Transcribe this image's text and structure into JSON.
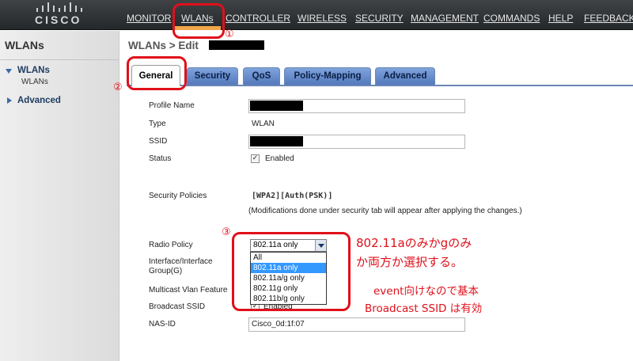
{
  "brand": {
    "logo_text": "CISCO"
  },
  "nav": {
    "items": [
      "MONITOR",
      "WLANs",
      "CONTROLLER",
      "WIRELESS",
      "SECURITY",
      "MANAGEMENT",
      "COMMANDS",
      "HELP",
      "FEEDBACK"
    ],
    "active": "WLANs",
    "accent_color": "#f2a64a"
  },
  "sidebar": {
    "title": "WLANs",
    "items": [
      {
        "label": "WLANs",
        "expanded": true,
        "sub": [
          "WLANs"
        ]
      },
      {
        "label": "Advanced",
        "expanded": false
      }
    ]
  },
  "page": {
    "title": "WLANs > Edit"
  },
  "tabs": [
    {
      "label": "General",
      "active": true
    },
    {
      "label": "Security"
    },
    {
      "label": "QoS"
    },
    {
      "label": "Policy-Mapping"
    },
    {
      "label": "Advanced"
    }
  ],
  "form": {
    "profile_name_label": "Profile Name",
    "type_label": "Type",
    "type_value": "WLAN",
    "ssid_label": "SSID",
    "status_label": "Status",
    "status_checkbox_label": "Enabled",
    "status_checked": true,
    "security_policies_label": "Security Policies",
    "security_policies_value": "[WPA2][Auth(PSK)]",
    "security_note": "(Modifications done under security tab will appear after applying the changes.)",
    "radio_policy_label": "Radio Policy",
    "radio_policy_selected": "802.11a only",
    "radio_policy_options": [
      "All",
      "802.11a only",
      "802.11a/g only",
      "802.11g only",
      "802.11b/g only"
    ],
    "interface_label_line1": "Interface/Interface",
    "interface_label_line2": "Group(G)",
    "multicast_label": "Multicast Vlan Feature",
    "broadcast_ssid_label": "Broadcast SSID",
    "broadcast_ssid_checkbox_label": "Enabled",
    "broadcast_checked": true,
    "nas_id_label": "NAS-ID",
    "nas_id_value": "Cisco_0d:1f:07"
  },
  "annotations": {
    "color": "#e0101a",
    "marker1": "①",
    "marker2": "②",
    "marker3": "③",
    "note1_line1": "802.11aのみかgのみ",
    "note1_line2": "か両方か選択する。",
    "note2_line1": "event向けなので基本",
    "note2_line2": "Broadcast SSID は有効"
  }
}
